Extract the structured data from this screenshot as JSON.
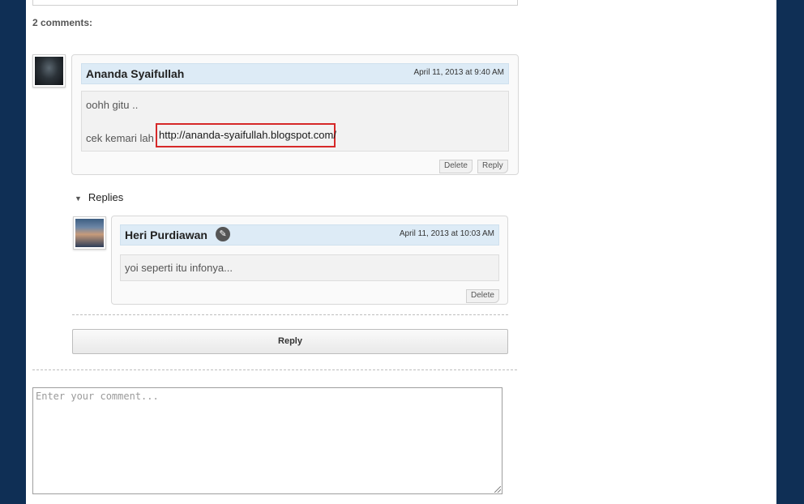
{
  "comments_count": "2 comments:",
  "comment1": {
    "author": "Ananda Syaifullah",
    "date": "April 11, 2013 at 9:40 AM",
    "line1": "oohh gitu ..",
    "line2_prefix": "cek kemari lah",
    "link": "http://ananda-syaifullah.blogspot.com/",
    "delete_label": "Delete",
    "reply_label": "Reply"
  },
  "replies_label": "Replies",
  "reply1": {
    "author": "Heri Purdiawan",
    "date": "April 11, 2013 at 10:03 AM",
    "text": "yoi seperti itu infonya...",
    "delete_label": "Delete",
    "edit_icon": "pencil-icon"
  },
  "reply_button_label": "Reply",
  "comment_input": {
    "placeholder": "Enter your comment..."
  },
  "colors": {
    "frame": "#0f2f55",
    "header_bg": "#ddebf6",
    "highlight": "#d62828"
  }
}
